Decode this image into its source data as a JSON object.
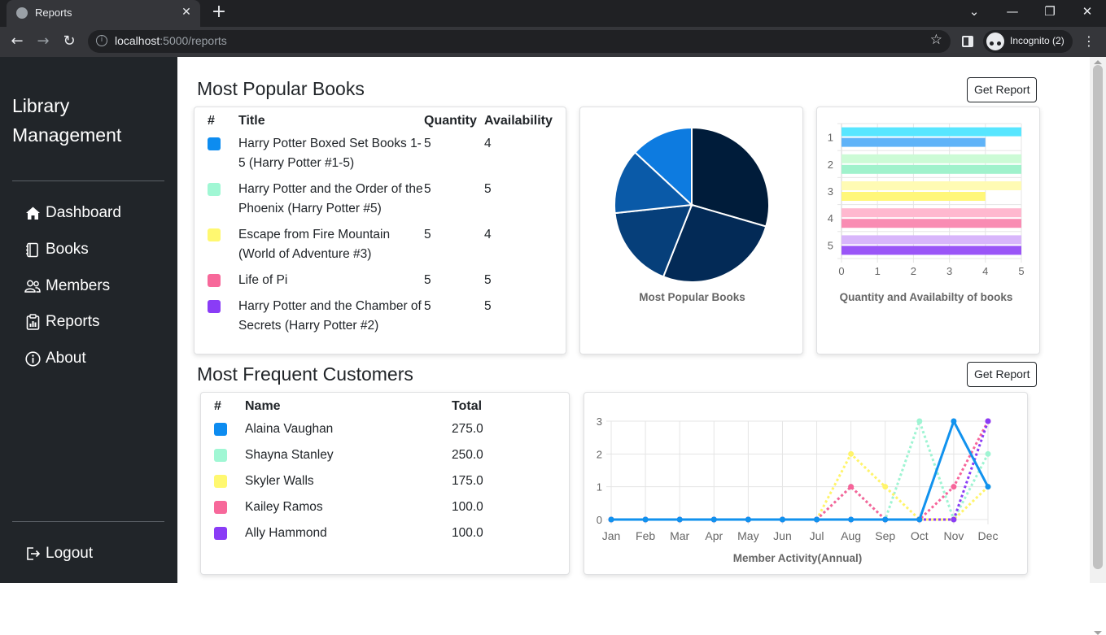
{
  "browser": {
    "tab_title": "Reports",
    "url_host": "localhost",
    "url_path": ":5000/reports",
    "profile_label": "Incognito (2)"
  },
  "sidebar": {
    "brand": "Library Management",
    "items": [
      {
        "label": "Dashboard",
        "icon": "house-icon"
      },
      {
        "label": "Books",
        "icon": "book-icon"
      },
      {
        "label": "Members",
        "icon": "people-icon"
      },
      {
        "label": "Reports",
        "icon": "report-icon"
      },
      {
        "label": "About",
        "icon": "info-icon"
      }
    ],
    "logout": "Logout"
  },
  "popular": {
    "heading": "Most Popular Books",
    "button": "Get Report",
    "columns": [
      "#",
      "Title",
      "Quantity",
      "Availability"
    ],
    "rows": [
      {
        "color": "#0d8cf0",
        "title": "Harry Potter Boxed Set Books 1-5 (Harry Potter #1-5)",
        "quantity": "5",
        "availability": "4"
      },
      {
        "color": "#a0f7d4",
        "title": "Harry Potter and the Order of the Phoenix (Harry Potter #5)",
        "quantity": "5",
        "availability": "5"
      },
      {
        "color": "#fff870",
        "title": "Escape from Fire Mountain (World of Adventure #3)",
        "quantity": "5",
        "availability": "4"
      },
      {
        "color": "#f7689a",
        "title": "Life of Pi",
        "quantity": "5",
        "availability": "5"
      },
      {
        "color": "#8a3cf6",
        "title": "Harry Potter and the Chamber of Secrets (Harry Potter #2)",
        "quantity": "5",
        "availability": "5"
      }
    ]
  },
  "customers": {
    "heading": "Most Frequent Customers",
    "button": "Get Report",
    "columns": [
      "#",
      "Name",
      "Total"
    ],
    "rows": [
      {
        "color": "#0d8cf0",
        "name": "Alaina Vaughan",
        "total": "275.0"
      },
      {
        "color": "#a0f7d4",
        "name": "Shayna Stanley",
        "total": "250.0"
      },
      {
        "color": "#fff870",
        "name": "Skyler Walls",
        "total": "175.0"
      },
      {
        "color": "#f7689a",
        "name": "Kailey Ramos",
        "total": "100.0"
      },
      {
        "color": "#8a3cf6",
        "name": "Ally Hammond",
        "total": "100.0"
      }
    ]
  },
  "chart_data": [
    {
      "type": "pie",
      "title": "Most Popular Books",
      "values": [
        29.5,
        26.5,
        17.3,
        13.6,
        13.1
      ],
      "colors": [
        "#001c3a",
        "#032a56",
        "#063f7a",
        "#0a5aa8",
        "#0d7be0"
      ]
    },
    {
      "type": "bar",
      "orientation": "horizontal",
      "title": "Quantity and Availabilty of books",
      "categories": [
        "1",
        "2",
        "3",
        "4",
        "5"
      ],
      "xlim": [
        0,
        5
      ],
      "xticks": [
        "0",
        "1",
        "2",
        "3",
        "4",
        "5"
      ],
      "series": [
        {
          "values": [
            5,
            5,
            5,
            5,
            5
          ],
          "colors": [
            "#58e6ff",
            "#ccfbd6",
            "#fffbb4",
            "#ffb8cf",
            "#d8b6fb"
          ]
        },
        {
          "values": [
            4,
            5,
            4,
            5,
            5
          ],
          "colors": [
            "#5fb3f8",
            "#a0f2cc",
            "#fff77a",
            "#f98cb3",
            "#9a55f7"
          ]
        }
      ]
    },
    {
      "type": "line",
      "title": "Member Activity(Annual)",
      "categories": [
        "Jan",
        "Feb",
        "Mar",
        "Apr",
        "May",
        "Jun",
        "Jul",
        "Aug",
        "Sep",
        "Oct",
        "Nov",
        "Dec"
      ],
      "ylim": [
        0,
        3
      ],
      "yticks": [
        "0",
        "1",
        "2",
        "3"
      ],
      "series": [
        {
          "color": "#1192ee",
          "dashed": false,
          "values": [
            0,
            0,
            0,
            0,
            0,
            0,
            0,
            0,
            0,
            0,
            3,
            1
          ]
        },
        {
          "color": "#9ff4d3",
          "dashed": true,
          "values": [
            0,
            0,
            0,
            0,
            0,
            0,
            0,
            1,
            0,
            3,
            0,
            2
          ]
        },
        {
          "color": "#fff46a",
          "dashed": true,
          "values": [
            0,
            0,
            0,
            0,
            0,
            0,
            0,
            2,
            1,
            0,
            0,
            1
          ]
        },
        {
          "color": "#f7649a",
          "dashed": true,
          "values": [
            0,
            0,
            0,
            0,
            0,
            0,
            0,
            1,
            0,
            0,
            1,
            3
          ]
        },
        {
          "color": "#8a3cf6",
          "dashed": true,
          "values": [
            0,
            0,
            0,
            0,
            0,
            0,
            0,
            0,
            0,
            0,
            0,
            3
          ]
        }
      ]
    }
  ]
}
